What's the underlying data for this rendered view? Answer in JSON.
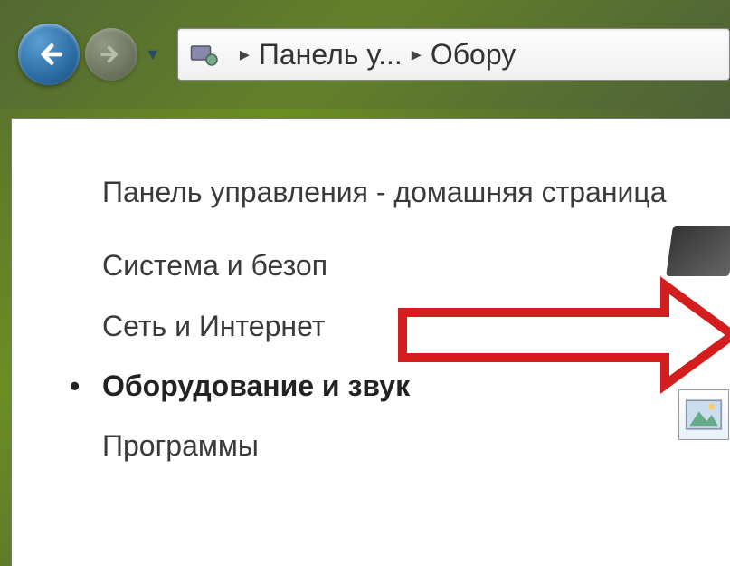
{
  "nav": {
    "dropdown_glyph": "▼"
  },
  "breadcrumb": {
    "sep": "▸",
    "crumb1": "Панель у...",
    "crumb2": "Обору"
  },
  "sidebar": {
    "title": "Панель управления - домашняя страница",
    "items": [
      {
        "label": "Система и безоп",
        "current": false
      },
      {
        "label": "Сеть и Интернет",
        "current": false
      },
      {
        "label": "Оборудование и звук",
        "current": true
      },
      {
        "label": "Программы",
        "current": false
      }
    ]
  },
  "colors": {
    "arrow": "#d41e1e"
  }
}
